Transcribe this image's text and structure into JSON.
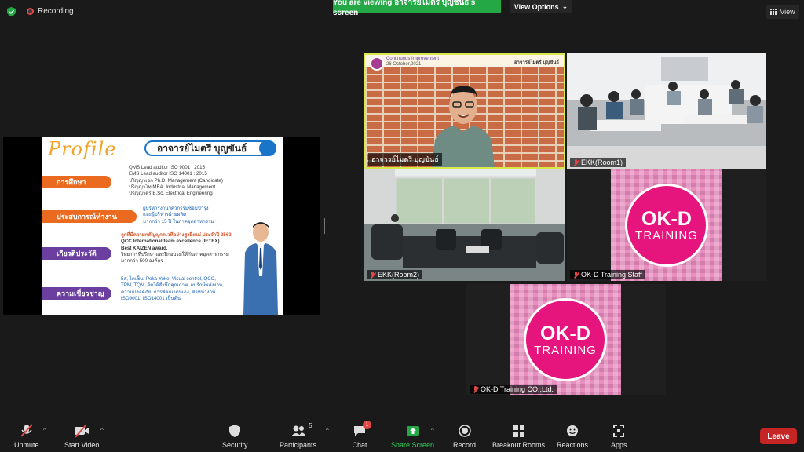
{
  "top": {
    "recording_label": "Recording",
    "viewing_banner": "You are viewing อาจารย์ไมตรี บุญชันธ์'s screen",
    "view_options_label": "View Options",
    "view_label": "View"
  },
  "slide": {
    "profile_word": "Profile",
    "name": "อาจารย์ไมตรี บุญขันธ์",
    "sections": [
      {
        "label": "การศึกษา",
        "color": "#ea6a1f"
      },
      {
        "label": "ประสบการณ์ทำงาน",
        "color": "#ea6a1f"
      },
      {
        "label": "เกียรติประวัติ",
        "color": "#6b3fa0"
      },
      {
        "label": "ความเชี่ยวชาญ",
        "color": "#6b3fa0"
      }
    ],
    "education_lines": [
      "QMS Lead auditor ISO 9001 : 2015",
      "EMS Lead auditor ISO 14001 : 2015",
      "ปริญญาเอก Ph.D. Management (Candidate)",
      "ปริญญาโท MBA. Industrial Management",
      "ปริญญาตรี B.Sc. Electrical Engineering"
    ],
    "experience_lines": [
      "ผู้บริหารงานวิศวกรรมซ่อมบำรุง",
      "และผู้บริหารฝ่ายผลิต",
      "มากกว่า 15 ปี ในภาคอุตสาหกรรม"
    ],
    "honor_lines": [
      "ลูกที่มีความกตัญญูกตเวทีอย่างสูงยิ่งแม่ ประจำปี 2563",
      "QCC International team excellence (IETEX)",
      "Best KAIZEN award.",
      "วิทยากรที่ปรึกษาและฝึกอบรมให้กับภาคอุตสาหกรรม",
      "มากกว่า 500 องค์กร"
    ],
    "expertise_lines": [
      "5ส, ไคเซ็น, Poka-Yoke, Visual control, QCC,",
      "TPM, TQM, จิตใต้สำนึกคุณภาพ, อนุรักษ์พลังงาน,",
      "ความปลอดภัย, การพัฒนาตนเอง, หัวหน้างาน",
      "ISO9001, ISO14001 เป็นต้น"
    ]
  },
  "tiles": {
    "host": {
      "name": "อาจารย์ไมตรี บุญขันธ์",
      "header_left_1": "Continuous Improvement",
      "header_left_2": "26 October,2021",
      "header_right": "อาจารย์ไมตรี บุญขันธ์"
    },
    "room1": {
      "name": "EKK(Room1)"
    },
    "room2": {
      "name": "EKK(Room2)"
    },
    "staff": {
      "name": "OK-D Training Staff"
    },
    "company": {
      "name": "OK-D Training CO.,Ltd."
    },
    "okd_big": "OK-D",
    "okd_small": "TRAINING"
  },
  "toolbar": {
    "unmute": "Unmute",
    "start_video": "Start Video",
    "security": "Security",
    "participants": "Participants",
    "participants_count": "5",
    "chat": "Chat",
    "chat_badge": "1",
    "share_screen": "Share Screen",
    "record": "Record",
    "breakout_rooms": "Breakout Rooms",
    "reactions": "Reactions",
    "apps": "Apps",
    "leave": "Leave"
  },
  "colors": {
    "accent_green": "#23a845",
    "leave_red": "#c62525",
    "okd_pink": "#e6157e",
    "active_speaker_border": "#d8e84a"
  }
}
